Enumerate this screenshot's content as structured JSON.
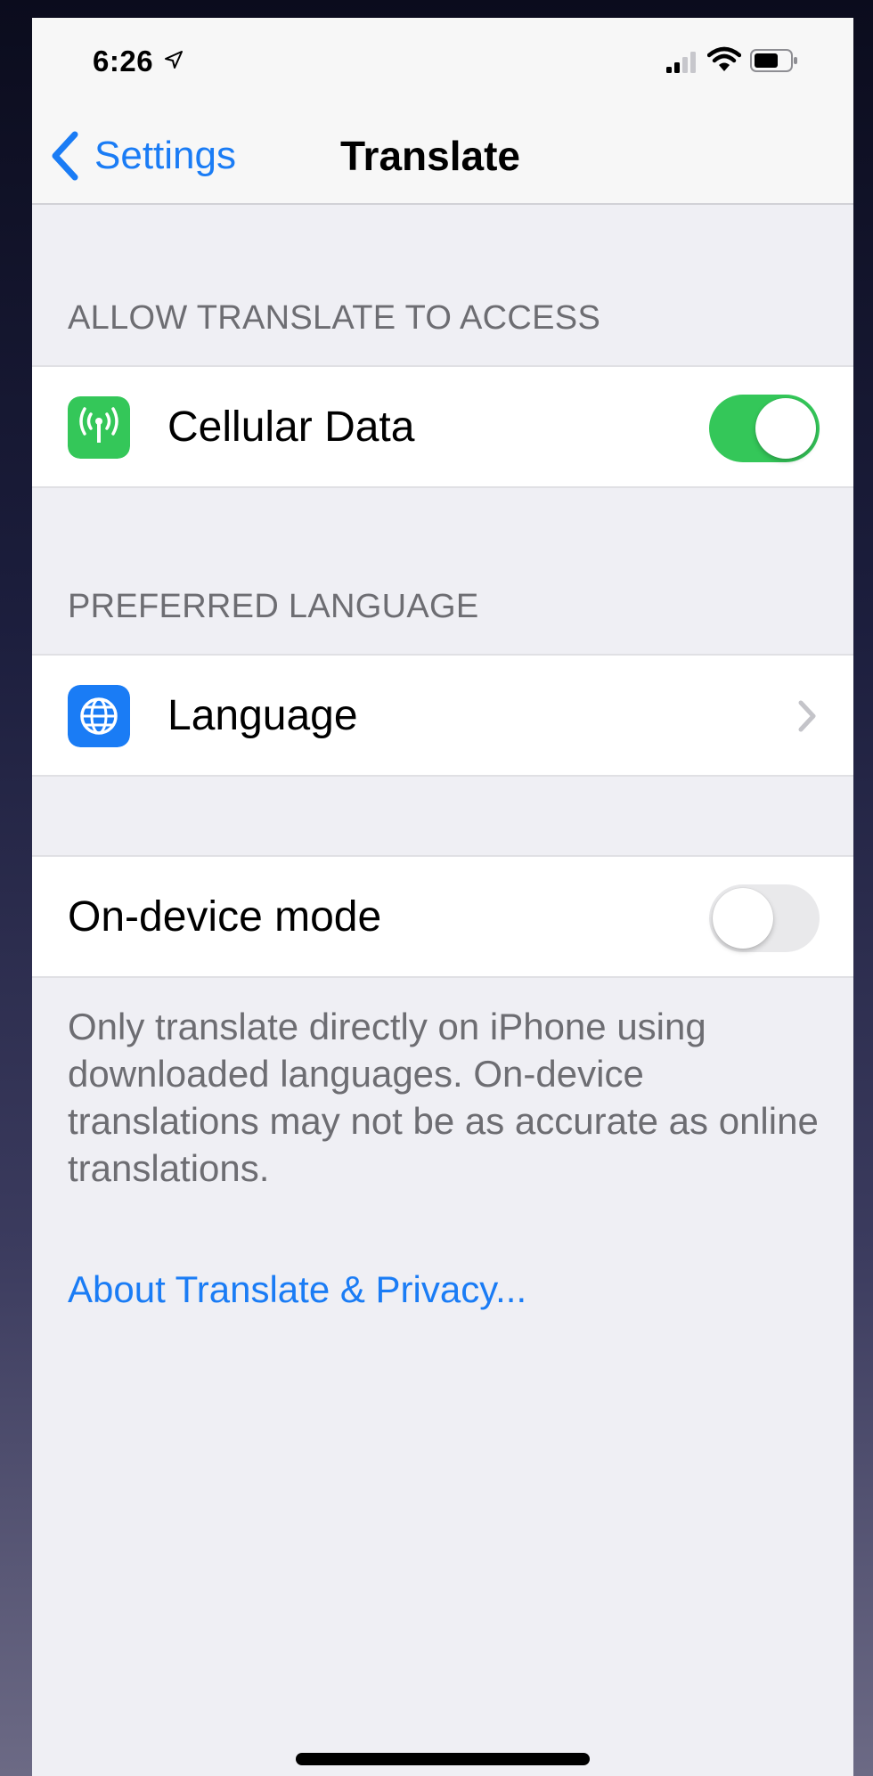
{
  "status_bar": {
    "time": "6:26",
    "location_icon": "location-arrow-icon",
    "signal_icon": "cellular-signal-icon",
    "wifi_icon": "wifi-icon",
    "battery_icon": "battery-icon"
  },
  "nav": {
    "back_label": "Settings",
    "title": "Translate"
  },
  "sections": {
    "access": {
      "header": "ALLOW TRANSLATE TO ACCESS",
      "cellular": {
        "label": "Cellular Data",
        "icon": "cellular-antenna-icon",
        "icon_color": "#34c759",
        "enabled": true
      }
    },
    "preferred_language": {
      "header": "PREFERRED LANGUAGE",
      "language": {
        "label": "Language",
        "icon": "globe-icon",
        "icon_color": "#1a7cf5"
      }
    },
    "on_device": {
      "label": "On-device mode",
      "enabled": false,
      "footer": "Only translate directly on iPhone using downloaded languages. On-device translations may not be as accurate as online translations."
    }
  },
  "privacy_link": "About Translate & Privacy...",
  "colors": {
    "accent": "#1a7cf5",
    "toggle_on": "#34c759",
    "background": "#efeff4"
  }
}
